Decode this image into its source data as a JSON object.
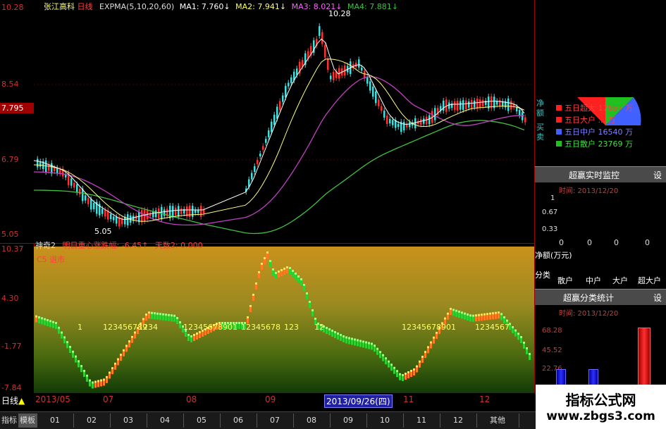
{
  "main_chart": {
    "stock_name": "张江高科",
    "period_label": "日线",
    "indicator_name": "EXPMA(5,10,20,60)",
    "ma1": "MA1: 7.760↓",
    "ma2": "MA2: 7.941↓",
    "ma3": "MA3: 8.021↓",
    "ma4": "MA4: 7.881↓",
    "y_ticks": [
      "10.28",
      "8.54",
      "6.79",
      "5.05"
    ],
    "current_price": "7.795",
    "high_label": "10.28",
    "low_label": "5.05"
  },
  "indicator_chart": {
    "name": "神奇2",
    "line1": "明日重心涨跌幅: -6.45↑",
    "line2": "天数2: 0.000",
    "line3": "C5 退市",
    "y_ticks": [
      "10.37",
      "4.30",
      "-1.77",
      "-7.84"
    ],
    "seq_labels": [
      "1",
      "123456789",
      "1234",
      "12345678901",
      "12345678",
      "123",
      "12",
      "12345678901",
      "1234567"
    ]
  },
  "right_panel": {
    "side_labels": [
      "净",
      "额",
      "买",
      "卖"
    ],
    "pie_legend": [
      {
        "label": "五日超大",
        "value": "17657",
        "unit": "万",
        "color": "#ff2020"
      },
      {
        "label": "五日大户",
        "value": "...",
        "unit": "万",
        "color": "#ff2020"
      },
      {
        "label": "五日中户",
        "value": "16540",
        "unit": "万",
        "color": "#4060ff"
      },
      {
        "label": "五日散户",
        "value": "23769",
        "unit": "万",
        "color": "#20c020"
      }
    ],
    "monitor": {
      "title": "超赢实时监控",
      "settings_label": "设",
      "time_label": "时间: 2013/12/20",
      "y_ticks": [
        "1",
        "0.67",
        "0.33"
      ],
      "zero_values": [
        "0",
        "0",
        "0",
        "0"
      ],
      "net_label": "净额(万元)",
      "category_label": "分类",
      "categories": [
        "散户",
        "中户",
        "大户",
        "超大户"
      ]
    },
    "stats": {
      "title": "超赢分类统计",
      "settings_label": "设",
      "time_label": "时间: 2013/12/20",
      "y_ticks": [
        "68.28",
        "45.52",
        "22.76"
      ],
      "bar_values": [
        22.76,
        22.76,
        68.28
      ]
    }
  },
  "bottom_bar": {
    "period": "日线",
    "months": [
      "2013/05",
      "07",
      "08",
      "09",
      "11",
      "12"
    ],
    "selected_date": "2013/09/26(四)",
    "tabs": [
      "指标",
      "模板",
      "01",
      "02",
      "03",
      "04",
      "05",
      "06",
      "07",
      "08",
      "09",
      "10",
      "11",
      "12",
      "其他"
    ]
  },
  "watermark": {
    "line1": "指标公式网",
    "line2": "www.zbgs3.com"
  },
  "colors": {
    "up": "#ff3030",
    "down": "#40e0e0",
    "ma1": "#ffffff",
    "ma2": "#ffff60",
    "ma3": "#ff60ff",
    "ma4": "#40c040"
  }
}
